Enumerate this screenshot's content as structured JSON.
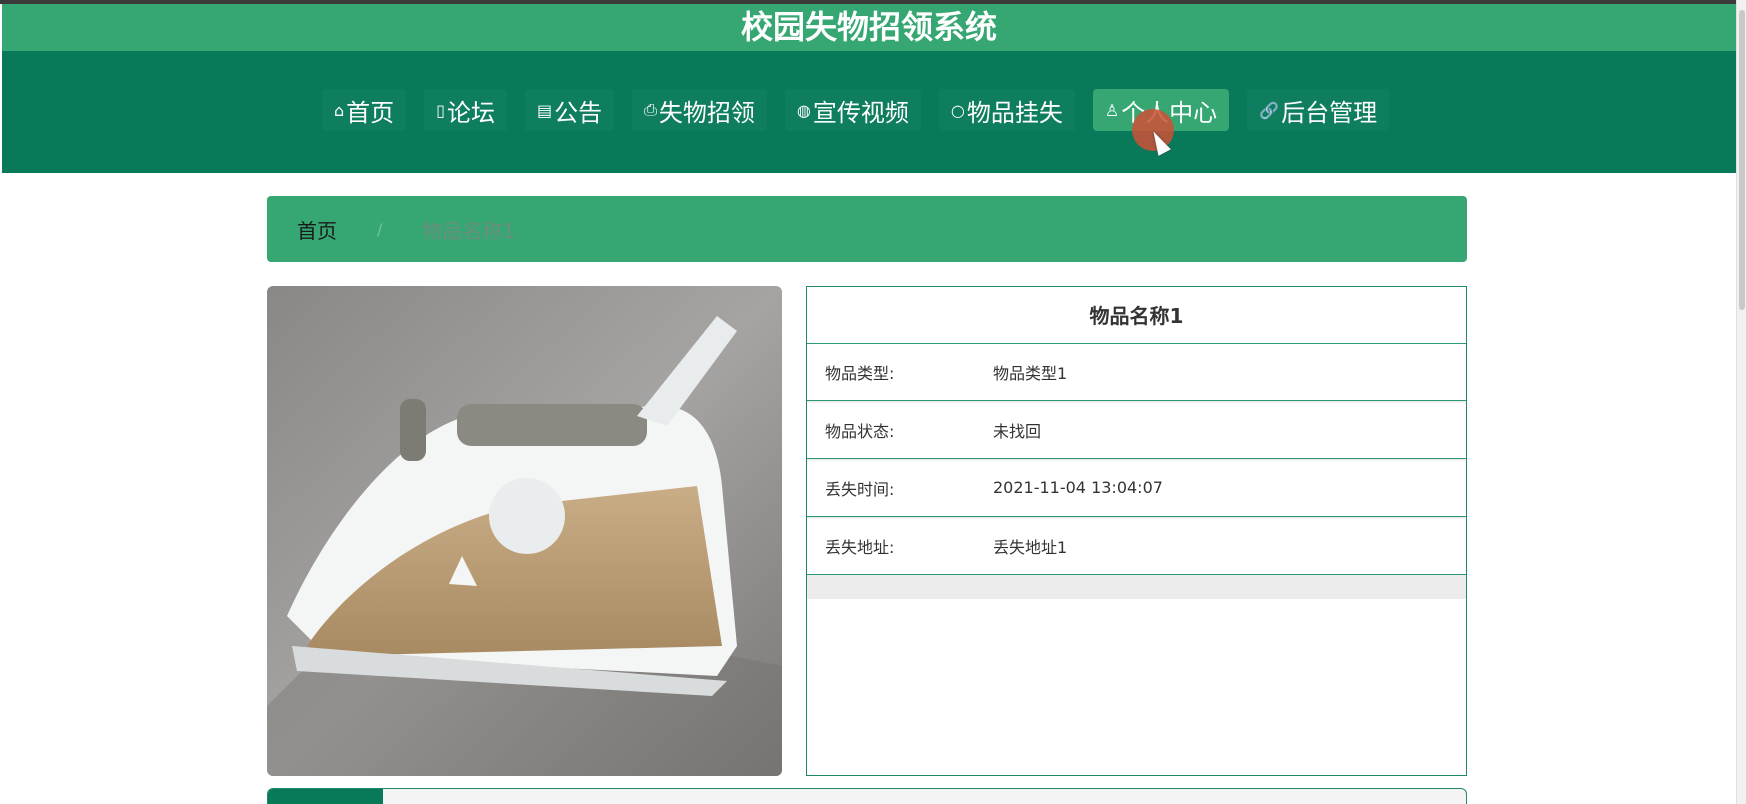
{
  "header": {
    "title": "校园失物招领系统"
  },
  "nav": {
    "items": [
      {
        "icon": "⌂",
        "label": "首页",
        "icon_name": "home-icon"
      },
      {
        "icon": "▯",
        "label": "论坛",
        "icon_name": "forum-icon"
      },
      {
        "icon": "▤",
        "label": "公告",
        "icon_name": "notice-icon"
      },
      {
        "icon": "⎙",
        "label": "失物招领",
        "icon_name": "lost-found-icon"
      },
      {
        "icon": "◍",
        "label": "宣传视频",
        "icon_name": "video-icon"
      },
      {
        "icon": "○",
        "label": "物品挂失",
        "icon_name": "report-loss-icon"
      },
      {
        "icon": "♙",
        "label": "个人中心",
        "icon_name": "user-icon"
      },
      {
        "icon": "🔗",
        "label": "后台管理",
        "icon_name": "link-icon"
      }
    ],
    "active_index": 6
  },
  "breadcrumb": {
    "home": "首页",
    "separator": "/",
    "current": "物品名称1"
  },
  "detail": {
    "title": "物品名称1",
    "rows": [
      {
        "label": "物品类型:",
        "value": "物品类型1"
      },
      {
        "label": "物品状态:",
        "value": "未找回"
      },
      {
        "label": "丢失时间:",
        "value": "2021-11-04 13:04:07"
      },
      {
        "label": "丢失地址:",
        "value": "丢失地址1"
      }
    ]
  },
  "colors": {
    "primary": "#36a773",
    "dark": "#087a5a"
  }
}
